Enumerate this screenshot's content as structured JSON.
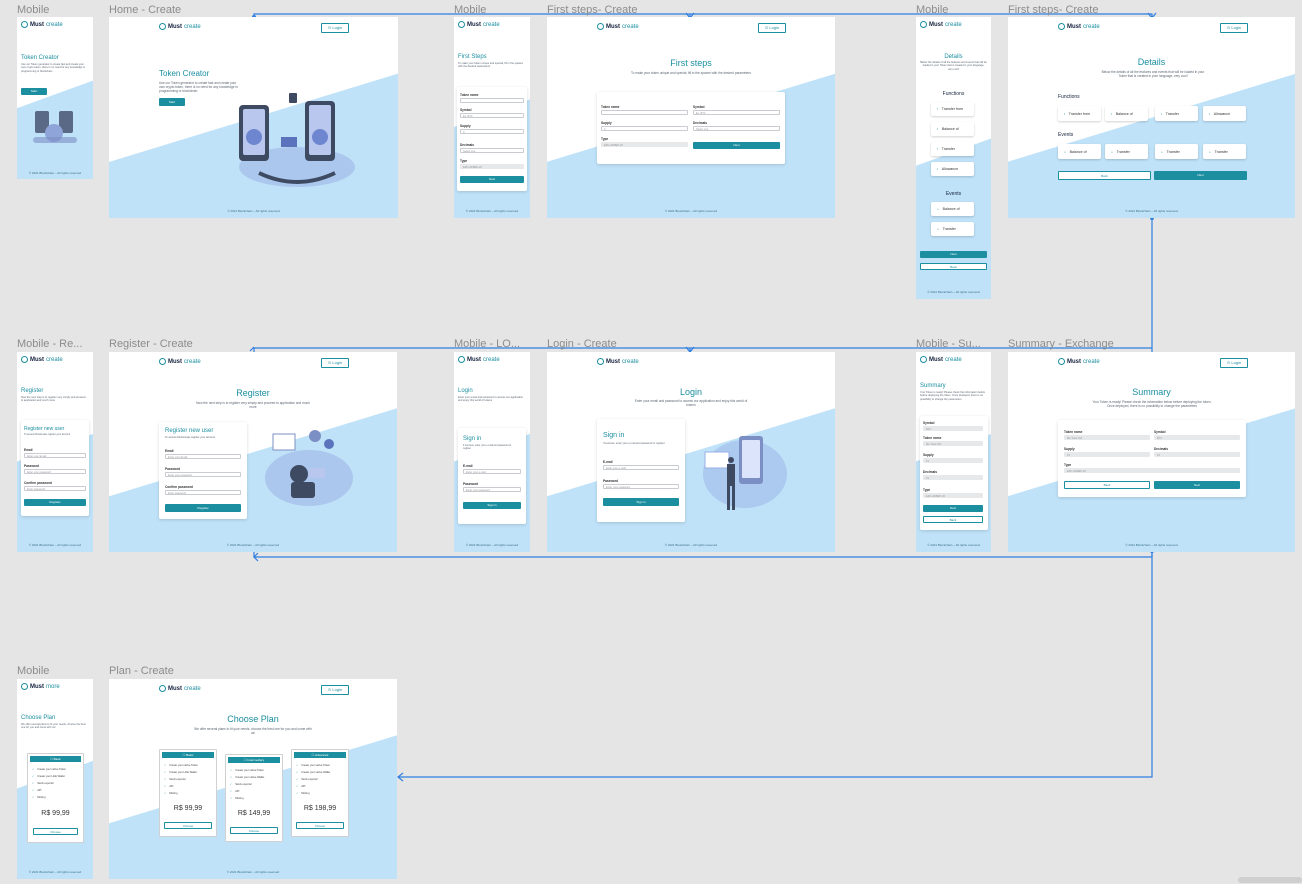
{
  "labels": {
    "mobile": "Mobile",
    "home_create": "Home - Create",
    "first_steps_create": "First steps- Create",
    "mobile_re": "Mobile - Re...",
    "register_create": "Register - Create",
    "mobile_lo": "Mobile - LO...",
    "login_create": "Login - Create",
    "mobile_su": "Mobile - Su...",
    "summary_exchange": "Summary - Exchange",
    "plan_create": "Plan - Create"
  },
  "brand": {
    "name_bold": "Must",
    "name_light": "create",
    "alt_bold": "Must",
    "alt_light": "more"
  },
  "common": {
    "login_btn": "⊙ Login",
    "footer": "© 2021 Blockchain – All rights reserved",
    "next": "Next",
    "back": "Back",
    "start": "Start"
  },
  "home": {
    "title": "Token Creator",
    "text": "Use our Token generator to create fast and create your own crypto token, there is no need for any knowledge in programming or blockchain"
  },
  "first_steps": {
    "title": "First steps",
    "text": "To make your token unique and special, fill in the spaces with the desired parameters",
    "fields": {
      "token_name": "Token name",
      "symbol": "Symbol",
      "symbol_ph": "Ex. BTC",
      "supply": "Supply",
      "supply_ph": "0",
      "decimals": "Decimals",
      "decimals_ph": "Select one",
      "type": "Type",
      "type_val": "ERC-20/BEP-20"
    },
    "mobile_title": "First Steps"
  },
  "details": {
    "title": "Details",
    "text": "Below the details of all the features and events that will be loaded in your Token that is created in your language, very cool!",
    "functions_label": "Functions",
    "events_label": "Events",
    "functions": [
      "Transfer from",
      "Balance of",
      "Transfer",
      "Allowance"
    ],
    "events": [
      "Balance of",
      "Transfer",
      "Transfer",
      "Transfer"
    ],
    "mobile_events": [
      "Balance of",
      "Transfer"
    ]
  },
  "register": {
    "title": "Register",
    "text": "Now the next step is to register very simply and proceed to application and much more",
    "card_title": "Register new user",
    "card_sub": "To access Mustcreate register your account",
    "email": "Email",
    "email_ph": "Enter your Email",
    "password": "Password",
    "password_ph": "Enter your password",
    "confirm": "Confirm password",
    "confirm_ph": "Enter password",
    "button": "Register"
  },
  "login": {
    "title": "Login",
    "text": "Enter your email and password to access our application and enjoy this world of tokens",
    "card_title": "Sign in",
    "card_sub": "If success, enter your e-mail and password or register",
    "email": "E-mail",
    "email_ph": "Enter your e-mail",
    "password": "Password",
    "password_ph": "Enter your password",
    "button": "Sign in"
  },
  "summary": {
    "title": "Summary",
    "text": "Your Token is ready! Please check the information below before deploying the token. Once deployed, there is no possibility to change the parameters",
    "token_name": "Token name",
    "token_name_val": "Me Teste fish",
    "symbol": "Symbol",
    "symbol_val": "BTC",
    "supply": "Supply",
    "supply_val": "15",
    "decimals": "Decimals",
    "decimals_val": "15",
    "type": "Type",
    "type_val": "ERC-20/BEP-20"
  },
  "plan": {
    "title": "Choose Plan",
    "text": "We offer several plans to fit your needs, choose the best one for you and come with us!",
    "choose": "Choose",
    "plans": [
      {
        "name": "Basic",
        "price": "R$ 99,99",
        "features": [
          "Create your native Token",
          "Create your Little Wallet",
          "Stock exporter",
          "API",
          "Minting"
        ]
      },
      {
        "name": "Intermediary",
        "price": "R$ 149,99",
        "features": [
          "Create your native Token",
          "Create your native Wallet",
          "Stock exporter",
          "API",
          "Minting"
        ]
      },
      {
        "name": "Advanced",
        "price": "R$ 198,99",
        "features": [
          "Create your native Token",
          "Create your native Wallet",
          "Stock exporter",
          "API",
          "Minting"
        ]
      }
    ]
  },
  "colors": {
    "accent": "#1b8ea0",
    "light_bg": "#bfe2f8",
    "canvas": "#e5e5e5",
    "connector": "#2f7fe0"
  }
}
